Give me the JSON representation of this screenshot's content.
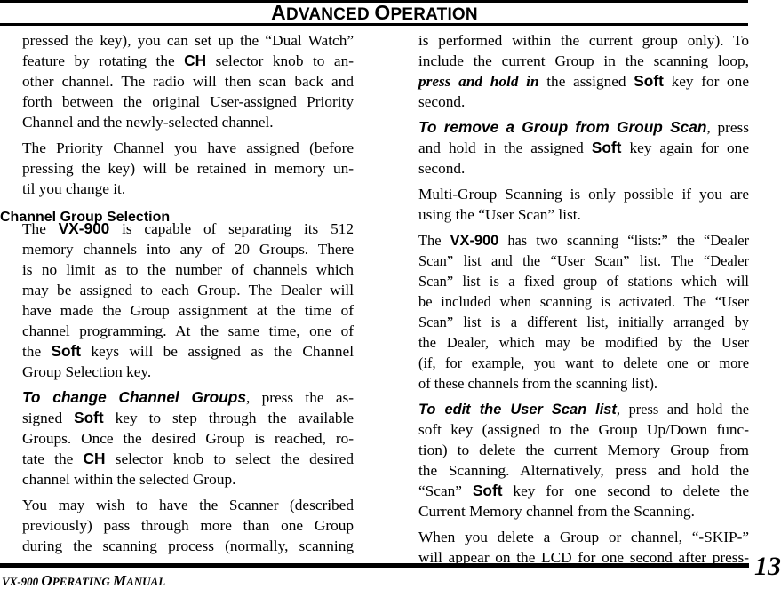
{
  "header": {
    "title_parts": [
      {
        "cap": "A",
        "rest": "DVANCED "
      },
      {
        "cap": "O",
        "rest": "PERATION"
      }
    ]
  },
  "footer": {
    "manual_prefix": "VX-900 ",
    "manual_parts": [
      {
        "cap": "O",
        "rest": "PERATING "
      },
      {
        "cap": "M",
        "rest": "ANUAL"
      }
    ],
    "page_number": "13"
  },
  "left_column": {
    "heading": "Channel Group Selection",
    "lines": [
      [
        {
          "t": "pressed the key), you can set up the “Dual Watch”"
        }
      ],
      [
        {
          "t": "feature by rotating the "
        },
        {
          "t": "CH",
          "s": "sans-b"
        },
        {
          "t": " selector knob to an-"
        }
      ],
      [
        {
          "t": "other channel. The radio will then scan back and"
        }
      ],
      [
        {
          "t": "forth between the original User-assigned Priority"
        }
      ],
      [
        {
          "t": "Channel and the newly-selected channel."
        }
      ],
      [
        {
          "t": "The Priority Channel you have assigned (before"
        }
      ],
      [
        {
          "t": "pressing the key) will be retained in memory un-"
        }
      ],
      [
        {
          "t": "til you change it."
        }
      ],
      [
        {
          "t": "The "
        },
        {
          "t": "VX-900",
          "s": "sans-b"
        },
        {
          "t": " is capable of separating its 512"
        }
      ],
      [
        {
          "t": "memory channels  into any of 20 Groups. There"
        }
      ],
      [
        {
          "t": "is no limit as to the number of channels which"
        }
      ],
      [
        {
          "t": "may be assigned to each Group. The Dealer will"
        }
      ],
      [
        {
          "t": "have made the Group assignment at the time of"
        }
      ],
      [
        {
          "t": "channel programming. At the same time, one of"
        }
      ],
      [
        {
          "t": "the "
        },
        {
          "t": "Soft",
          "s": "sans-b"
        },
        {
          "t": " keys will be assigned as the Channel"
        }
      ],
      [
        {
          "t": "Group Selection key."
        }
      ],
      [
        {
          "t": "To change Channel Groups",
          "s": "sans-bi"
        },
        {
          "t": ", press the as-"
        }
      ],
      [
        {
          "t": "signed "
        },
        {
          "t": "Soft",
          "s": "sans-b"
        },
        {
          "t": " key to step through the available"
        }
      ],
      [
        {
          "t": "Groups. Once the desired Group is reached, ro-"
        }
      ],
      [
        {
          "t": "tate the "
        },
        {
          "t": "CH",
          "s": "sans-b"
        },
        {
          "t": " selector knob to select the desired"
        }
      ],
      [
        {
          "t": "channel within the selected Group."
        }
      ],
      [
        {
          "t": "You may wish to have the Scanner (described"
        }
      ],
      [
        {
          "t": "previously) pass through more than one Group"
        }
      ],
      [
        {
          "t": "during the scanning process (normally, scanning"
        }
      ]
    ]
  },
  "right_column": {
    "lines": [
      [
        {
          "t": "is performed within the current group only). To"
        }
      ],
      [
        {
          "t": "include the current Group in the scanning loop,"
        }
      ],
      [
        {
          "t": "press and hold in",
          "s": "serif-bi"
        },
        {
          "t": " the assigned "
        },
        {
          "t": "Soft",
          "s": "sans-b"
        },
        {
          "t": " key for one"
        }
      ],
      [
        {
          "t": "second."
        }
      ],
      [
        {
          "t": "To remove a Group from Group Scan",
          "s": "sans-bi"
        },
        {
          "t": ", press"
        }
      ],
      [
        {
          "t": "and hold in the assigned "
        },
        {
          "t": "Soft",
          "s": "sans-b"
        },
        {
          "t": " key again for one"
        }
      ],
      [
        {
          "t": "second."
        }
      ],
      [
        {
          "t": "Multi-Group Scanning is only possible if you are"
        }
      ],
      [
        {
          "t": "using the “User Scan” list."
        }
      ],
      [
        {
          "t": "The "
        },
        {
          "t": "VX-900",
          "s": "sans-b"
        },
        {
          "t": " has two scanning “lists:” the “Dealer"
        }
      ],
      [
        {
          "t": "Scan” list and the “User Scan” list. The “Dealer"
        }
      ],
      [
        {
          "t": "Scan” list is a fixed group of stations which will"
        }
      ],
      [
        {
          "t": "be included when scanning is activated. The “User"
        }
      ],
      [
        {
          "t": "Scan” list is a different list, initially arranged by"
        }
      ],
      [
        {
          "t": "the Dealer, which may be modified by the User"
        }
      ],
      [
        {
          "t": "(if, for example, you want to delete one or more"
        }
      ],
      [
        {
          "t": "of these channels from the scanning list)."
        }
      ],
      [
        {
          "t": "To edit the User Scan list",
          "s": "sans-bi"
        },
        {
          "t": ", press and hold the"
        }
      ],
      [
        {
          "t": "soft key (assigned to the Group Up/Down func-"
        }
      ],
      [
        {
          "t": "tion) to delete the current Memory Group from"
        }
      ],
      [
        {
          "t": "the Scanning. Alternatively, press and hold the"
        }
      ],
      [
        {
          "t": "“Scan” "
        },
        {
          "t": "Soft",
          "s": "sans-b"
        },
        {
          "t": " key for one second to delete the"
        }
      ],
      [
        {
          "t": "Current Memory channel from the Scanning."
        }
      ],
      [
        {
          "t": "When you delete a Group or channel, “-SKIP-”"
        }
      ],
      [
        {
          "t": "will appear on the LCD for one second after press-"
        }
      ]
    ]
  }
}
